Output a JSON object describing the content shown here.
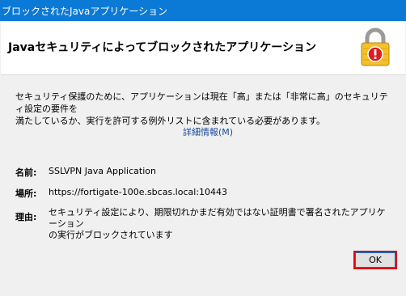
{
  "window": {
    "title": "ブロックされたJavaアプリケーション"
  },
  "header": {
    "heading": "Javaセキュリティによってブロックされたアプリケーション",
    "icon": "warning-lock-icon"
  },
  "message": {
    "line1": "セキュリティ保護のために、アプリケーションは現在「高」または「非常に高」のセキュリティ設定の要件を",
    "line2": "満たしているか、実行を許可する例外リストに含まれている必要があります。"
  },
  "details_link": "詳細情報(M)",
  "info": {
    "name_label": "名前:",
    "name_value": "SSLVPN Java Application",
    "location_label": "場所:",
    "location_value": "https://fortigate-100e.sbcas.local:10443",
    "reason_label": "理由:",
    "reason_line1": "セキュリティ設定により、期限切れかまだ有効ではない証明書で署名されたアプリケーション",
    "reason_line2": "の実行がブロックされています"
  },
  "buttons": {
    "ok": "OK"
  },
  "colors": {
    "titlebar": "#0b79d6",
    "link": "#1a4c9c",
    "highlight": "#d10f1b",
    "lock_body": "#f2c12e",
    "alert": "#d81e1e"
  }
}
